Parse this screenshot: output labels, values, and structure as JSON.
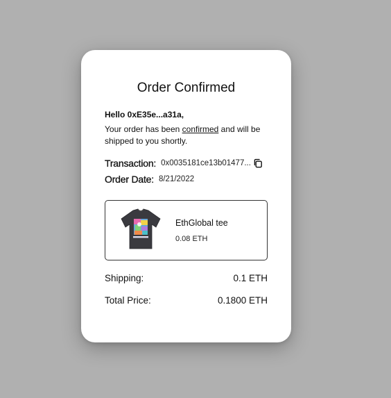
{
  "card": {
    "title": "Order Confirmed",
    "greeting": "Hello 0xE35e...a31a,",
    "message_before": "Your order has been ",
    "message_link": "confirmed",
    "message_after": " and will be shipped to you shortly.",
    "transaction_label": "Transaction:",
    "transaction_value": "0x0035181ce13b01477...",
    "order_date_label": "Order Date:",
    "order_date_value": "8/21/2022"
  },
  "product": {
    "name": "EthGlobal tee",
    "price": "0.08 ETH"
  },
  "summary": {
    "shipping_label": "Shipping:",
    "shipping_value": "0.1 ETH",
    "total_label": "Total Price:",
    "total_value": "0.1800 ETH"
  },
  "colors": {
    "background": "#b0b0b0",
    "card": "#ffffff",
    "text": "#111111",
    "shirt": "#3a3a3f"
  },
  "icons": {
    "copy": "copy-icon"
  }
}
